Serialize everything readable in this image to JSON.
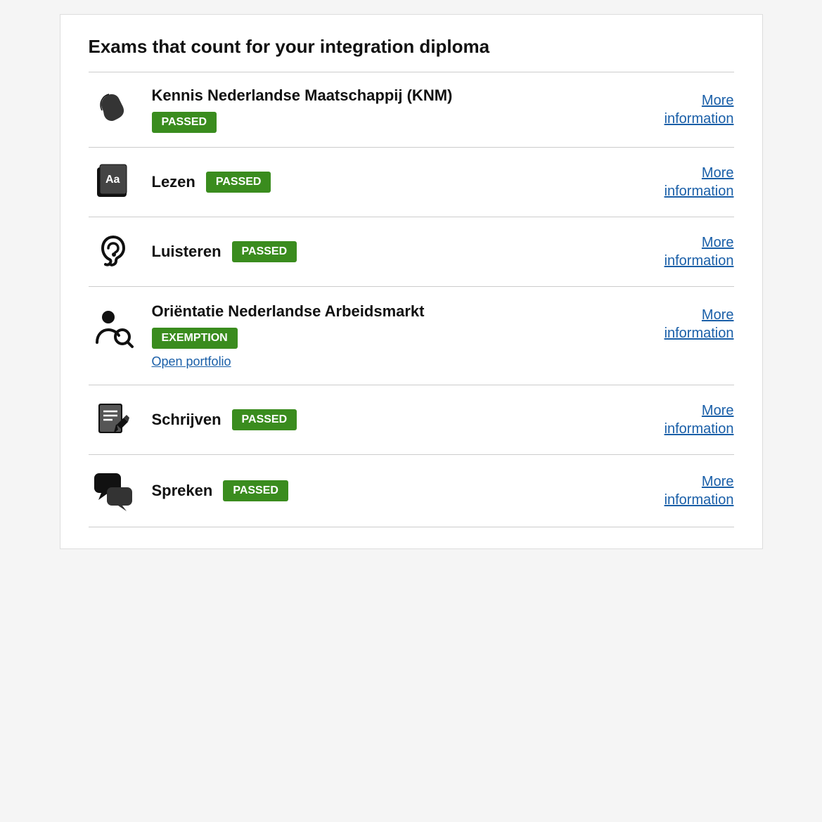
{
  "page": {
    "title": "Exams that count for your integration diploma"
  },
  "exams": [
    {
      "id": "knm",
      "name": "Kennis Nederlandse Maatschappij (KNM)",
      "icon": "knm",
      "badge": "PASSED",
      "badge_type": "passed",
      "inline_badge": false,
      "extra_link": null,
      "more_info_label": "More\ninformation"
    },
    {
      "id": "lezen",
      "name": "Lezen",
      "icon": "lezen",
      "badge": "PASSED",
      "badge_type": "passed",
      "inline_badge": true,
      "extra_link": null,
      "more_info_label": "More\ninformation"
    },
    {
      "id": "luisteren",
      "name": "Luisteren",
      "icon": "luisteren",
      "badge": "PASSED",
      "badge_type": "passed",
      "inline_badge": true,
      "extra_link": null,
      "more_info_label": "More\ninformation"
    },
    {
      "id": "ona",
      "name": "Oriëntatie Nederlandse Arbeidsmarkt",
      "icon": "ona",
      "badge": "EXEMPTION",
      "badge_type": "exemption",
      "inline_badge": false,
      "extra_link": "Open portfolio",
      "more_info_label": "More\ninformation"
    },
    {
      "id": "schrijven",
      "name": "Schrijven",
      "icon": "schrijven",
      "badge": "PASSED",
      "badge_type": "passed",
      "inline_badge": true,
      "extra_link": null,
      "more_info_label": "More\ninformation"
    },
    {
      "id": "spreken",
      "name": "Spreken",
      "icon": "spreken",
      "badge": "PASSED",
      "badge_type": "passed",
      "inline_badge": true,
      "extra_link": null,
      "more_info_label": "More\ninformation"
    }
  ],
  "colors": {
    "passed": "#3a8c1e",
    "exemption": "#3a8c1e",
    "link": "#1a5fa8"
  }
}
